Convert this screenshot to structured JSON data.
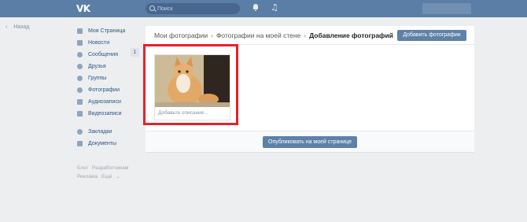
{
  "topbar": {
    "logo": "VK",
    "search_placeholder": "Поиск"
  },
  "back_link": "Назад",
  "sidebar": {
    "items": [
      {
        "label": "Моя Страница",
        "icon": "home-icon"
      },
      {
        "label": "Новости",
        "icon": "news-icon"
      },
      {
        "label": "Сообщения",
        "icon": "messages-icon"
      },
      {
        "label": "Друзья",
        "icon": "friends-icon"
      },
      {
        "label": "Группы",
        "icon": "groups-icon"
      },
      {
        "label": "Фотографии",
        "icon": "photos-icon"
      },
      {
        "label": "Аудиозаписи",
        "icon": "audio-icon"
      },
      {
        "label": "Видеозаписи",
        "icon": "video-icon"
      },
      {
        "label": "Закладки",
        "icon": "bookmarks-icon"
      },
      {
        "label": "Документы",
        "icon": "documents-icon"
      }
    ],
    "messages_badge": "1",
    "footer": [
      "Блог",
      "Разработчикам",
      "Реклама",
      "Ещё"
    ]
  },
  "breadcrumb": {
    "items": [
      "Мои фотографии",
      "Фотографии на моей стене"
    ],
    "separator": "›",
    "current": "Добавление фотографий"
  },
  "add_photos_label": "Добавить фотографии",
  "photo": {
    "description_placeholder": "Добавьте описание..."
  },
  "publish_label": "Опубликовать на моей странице",
  "colors": {
    "topbar": "#5b7ea6",
    "button": "#5e81a8",
    "highlight": "#e0242a"
  }
}
